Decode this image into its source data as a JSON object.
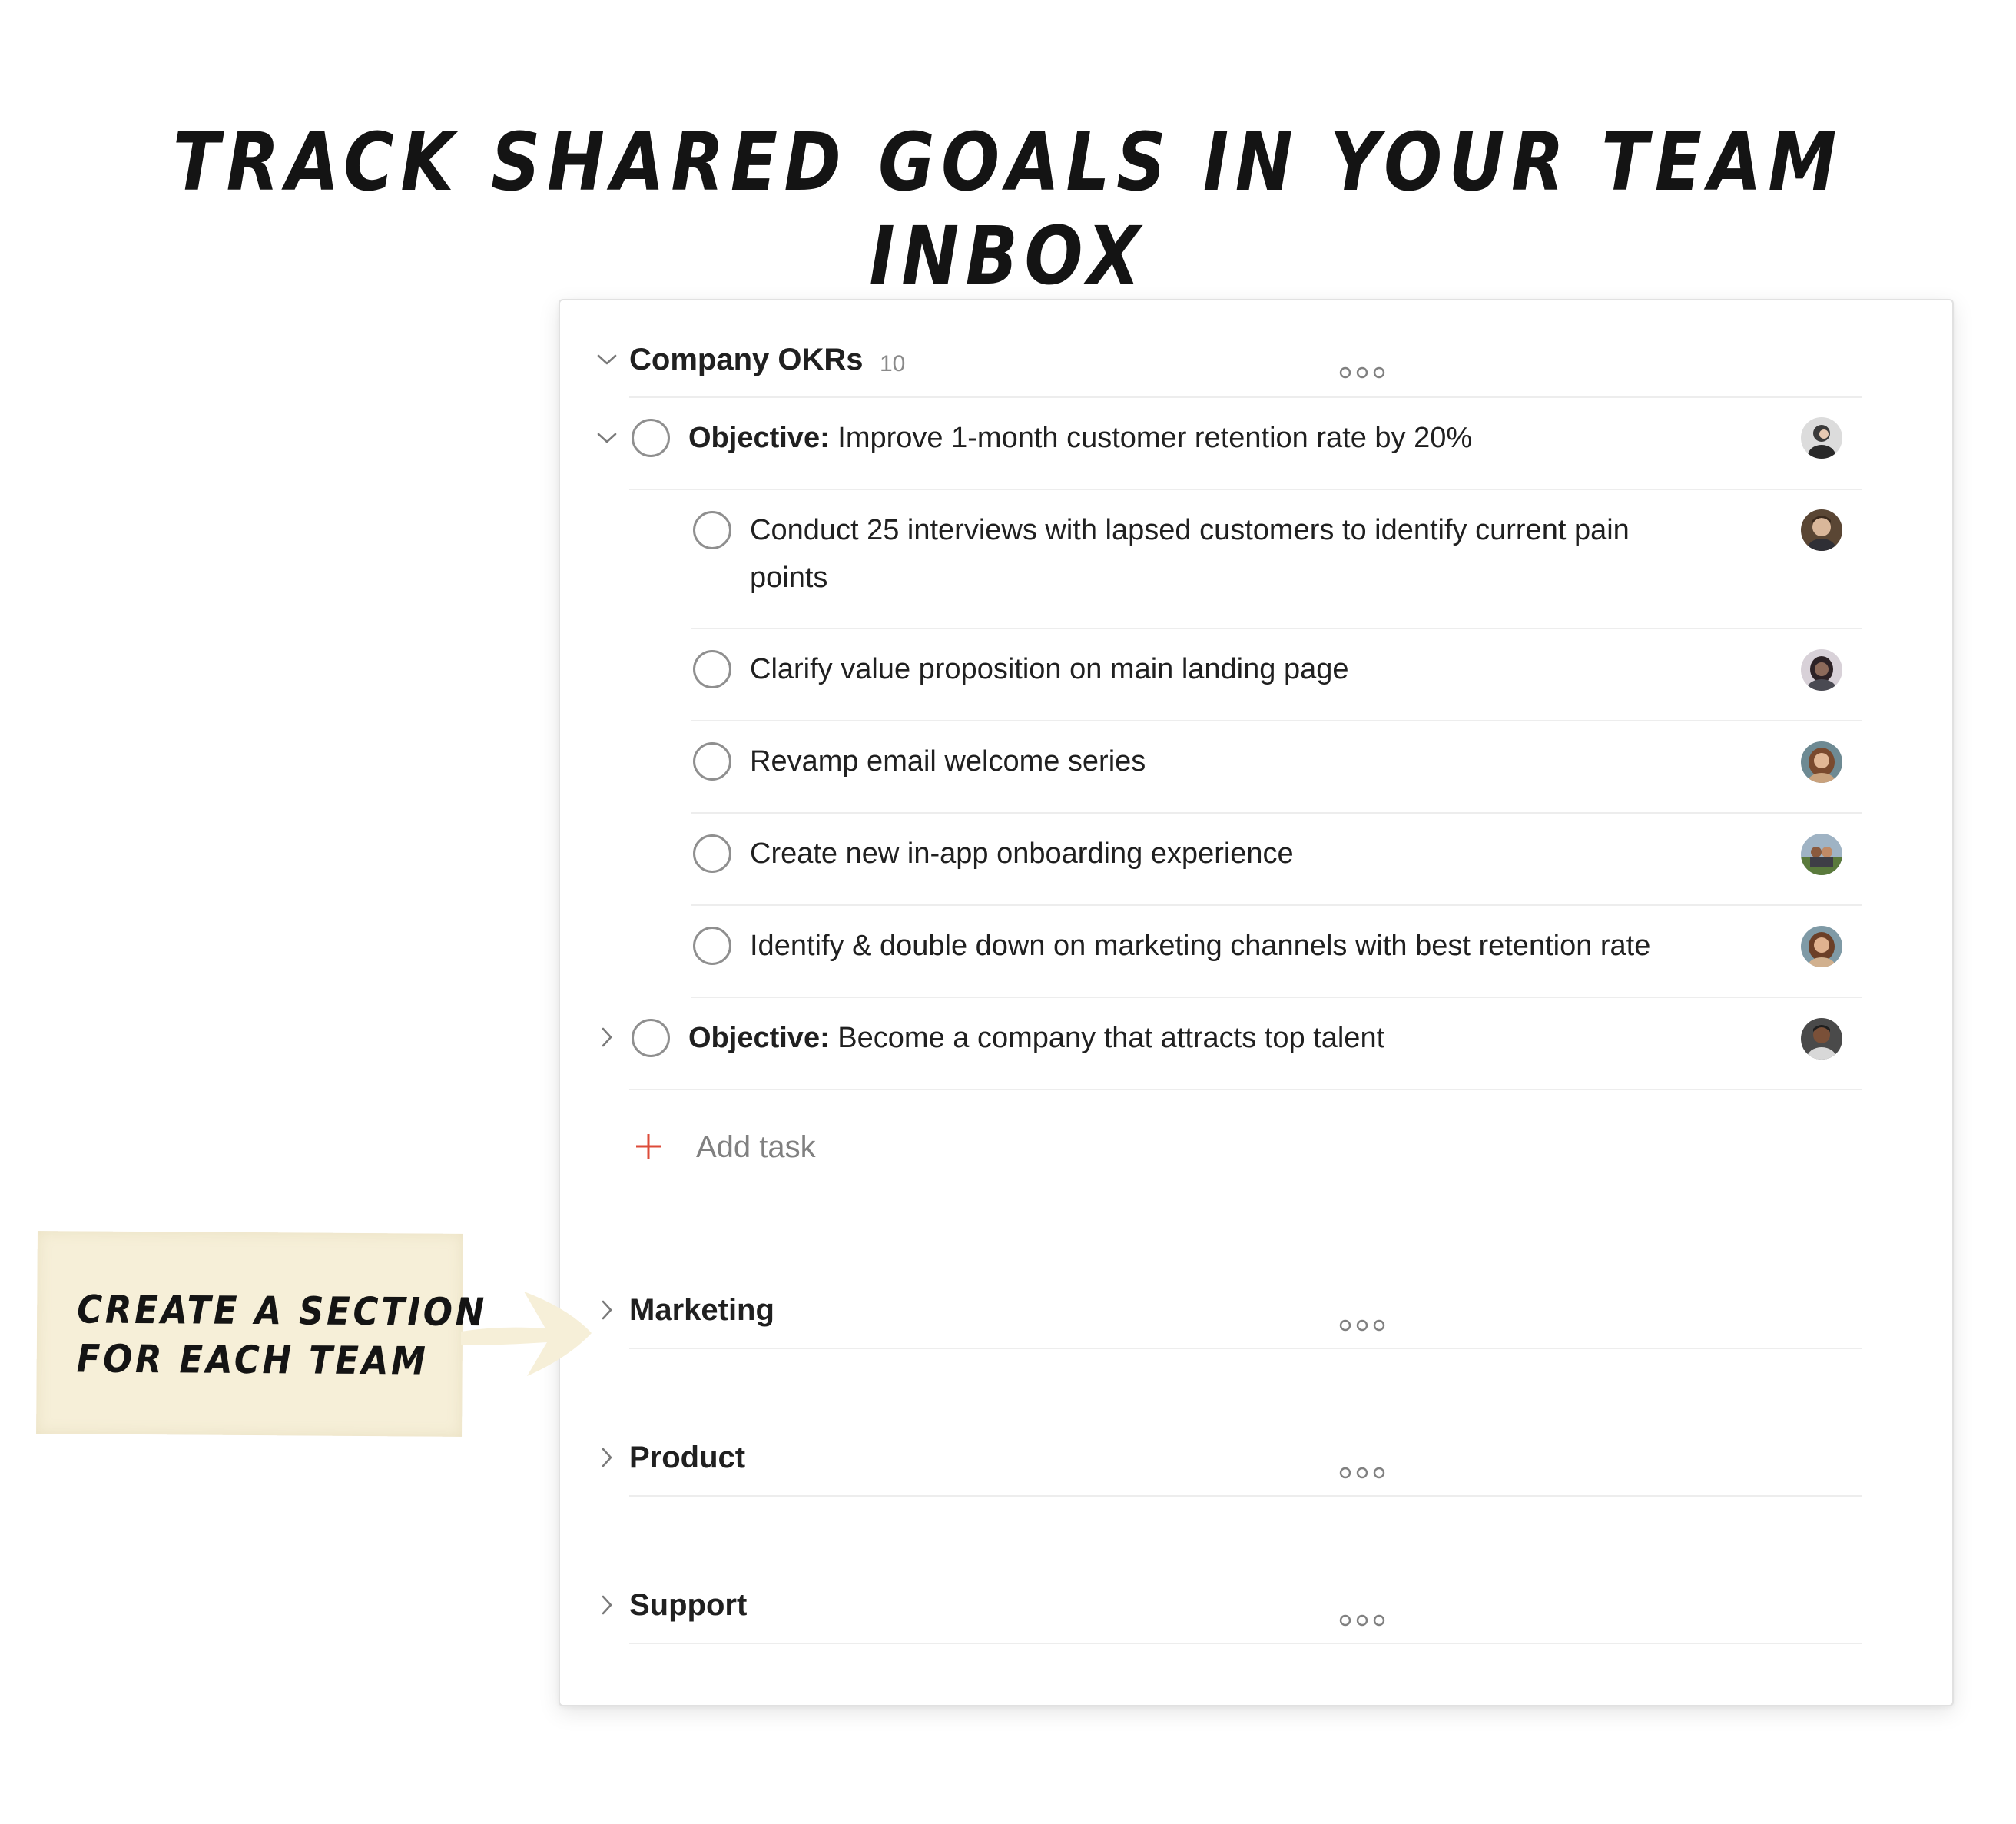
{
  "headline": "TRACK SHARED GOALS IN YOUR TEAM INBOX",
  "sections": {
    "okrs": {
      "title": "Company OKRs",
      "count": "10",
      "more_icon": "more-horizontal-icon"
    },
    "marketing": {
      "title": "Marketing",
      "more_icon": "more-horizontal-icon"
    },
    "product": {
      "title": "Product",
      "more_icon": "more-horizontal-icon"
    },
    "support": {
      "title": "Support",
      "more_icon": "more-horizontal-icon"
    }
  },
  "tasks": {
    "objective1": {
      "prefix": "Objective:",
      "text": "Improve 1-month customer retention rate by 20%"
    },
    "sub1": {
      "line1": "Conduct 25 interviews with lapsed customers to identify current pain",
      "line2": "points"
    },
    "sub2": {
      "text": "Clarify value proposition on main landing page"
    },
    "sub3": {
      "text": "Revamp email welcome series"
    },
    "sub4": {
      "text": "Create new in-app onboarding experience"
    },
    "sub5": {
      "text": "Identify & double down on marketing channels with best retention rate"
    },
    "objective2": {
      "prefix": "Objective:",
      "text": "Become a company that attracts top talent"
    }
  },
  "add_task": {
    "label": "Add task",
    "icon": "plus-icon",
    "icon_color": "#dd4b39"
  },
  "callout": {
    "line1": "CREATE A SECTION",
    "line2": "FOR EACH TEAM",
    "background": "#f6efd8"
  }
}
